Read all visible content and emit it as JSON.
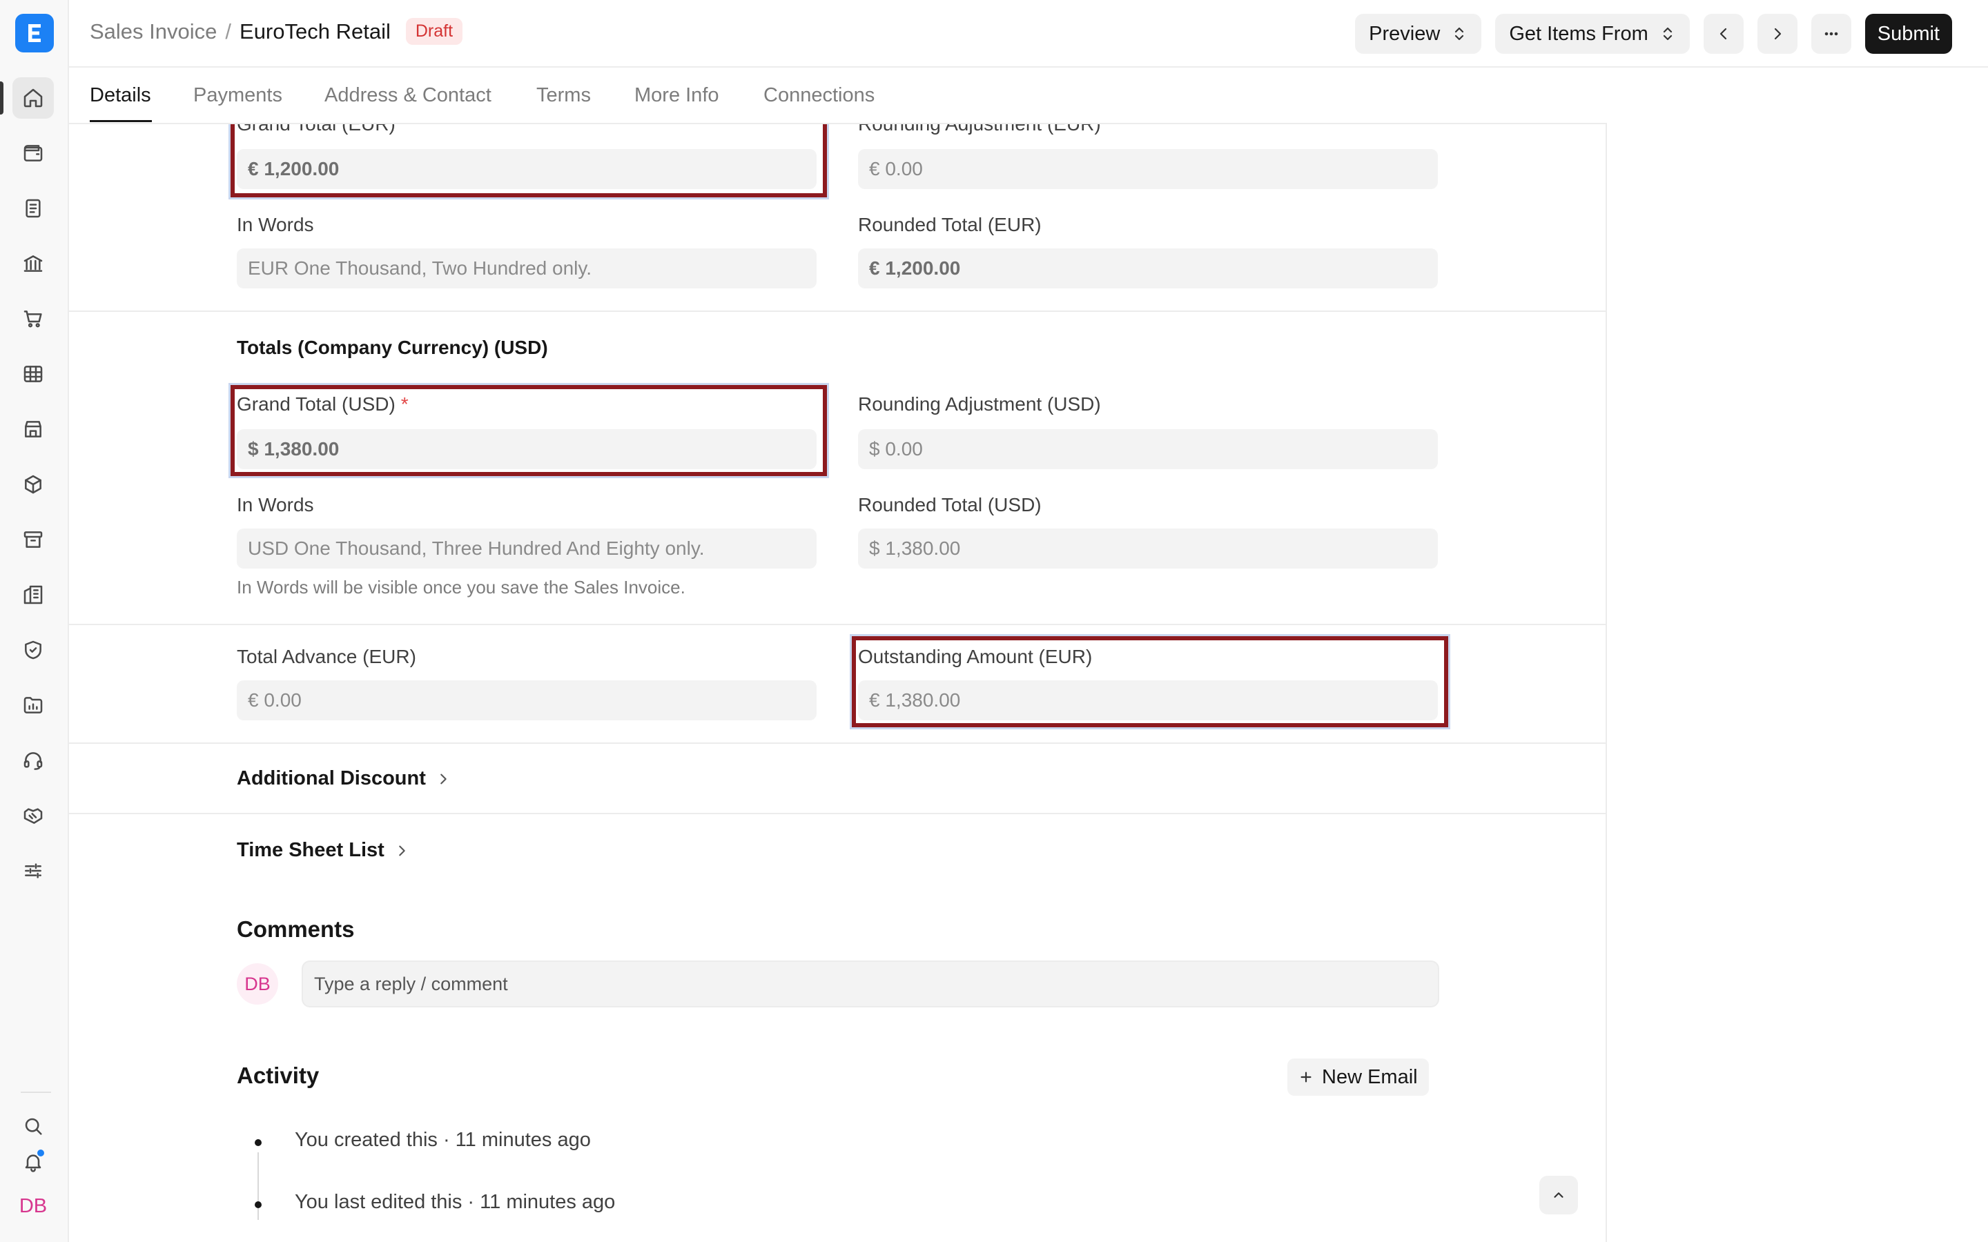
{
  "app": {
    "logo_letter": "E",
    "user_initials": "DB"
  },
  "breadcrumb": {
    "parent": "Sales Invoice",
    "separator": "/",
    "current": "EuroTech Retail",
    "status": "Draft"
  },
  "toolbar": {
    "preview_label": "Preview",
    "get_items_label": "Get Items From",
    "submit_label": "Submit"
  },
  "tabs": [
    {
      "label": "Details",
      "active": true
    },
    {
      "label": "Payments"
    },
    {
      "label": "Address & Contact"
    },
    {
      "label": "Terms"
    },
    {
      "label": "More Info"
    },
    {
      "label": "Connections"
    }
  ],
  "totals_eur": {
    "grand_total_label": "Grand Total (EUR)",
    "grand_total_value": "€ 1,200.00",
    "rounding_label": "Rounding Adjustment (EUR)",
    "rounding_value": "€ 0.00",
    "in_words_label": "In Words",
    "in_words_value": "EUR One Thousand, Two Hundred only.",
    "rounded_total_label": "Rounded Total (EUR)",
    "rounded_total_value": "€ 1,200.00"
  },
  "totals_usd": {
    "section_title": "Totals (Company Currency) (USD)",
    "grand_total_label": "Grand Total (USD)",
    "grand_total_value": "$ 1,380.00",
    "rounding_label": "Rounding Adjustment (USD)",
    "rounding_value": "$ 0.00",
    "in_words_label": "In Words",
    "in_words_value": "USD One Thousand, Three Hundred And Eighty only.",
    "rounded_total_label": "Rounded Total (USD)",
    "rounded_total_value": "$ 1,380.00",
    "help_text": "In Words will be visible once you save the Sales Invoice."
  },
  "advance": {
    "total_advance_label": "Total Advance (EUR)",
    "total_advance_value": "€ 0.00",
    "outstanding_label": "Outstanding Amount (EUR)",
    "outstanding_value": "€ 1,380.00"
  },
  "sections": {
    "additional_discount": "Additional Discount",
    "time_sheet_list": "Time Sheet List"
  },
  "comments": {
    "title": "Comments",
    "avatar": "DB",
    "placeholder": "Type a reply / comment"
  },
  "activity": {
    "title": "Activity",
    "new_email_label": "New Email",
    "items": [
      "You created this · 11 minutes ago",
      "You last edited this · 11 minutes ago"
    ]
  },
  "highlight_color": "#8d1a1f",
  "icons": {
    "sidebar": [
      "home-icon",
      "wallet-icon",
      "file-text-icon",
      "bank-icon",
      "cart-icon",
      "table-icon",
      "store-icon",
      "package-icon",
      "archive-icon",
      "building-icon",
      "shield-icon",
      "folder-chart-icon",
      "headset-icon",
      "handshake-icon",
      "sliders-icon",
      "search-icon",
      "bell-icon"
    ]
  }
}
